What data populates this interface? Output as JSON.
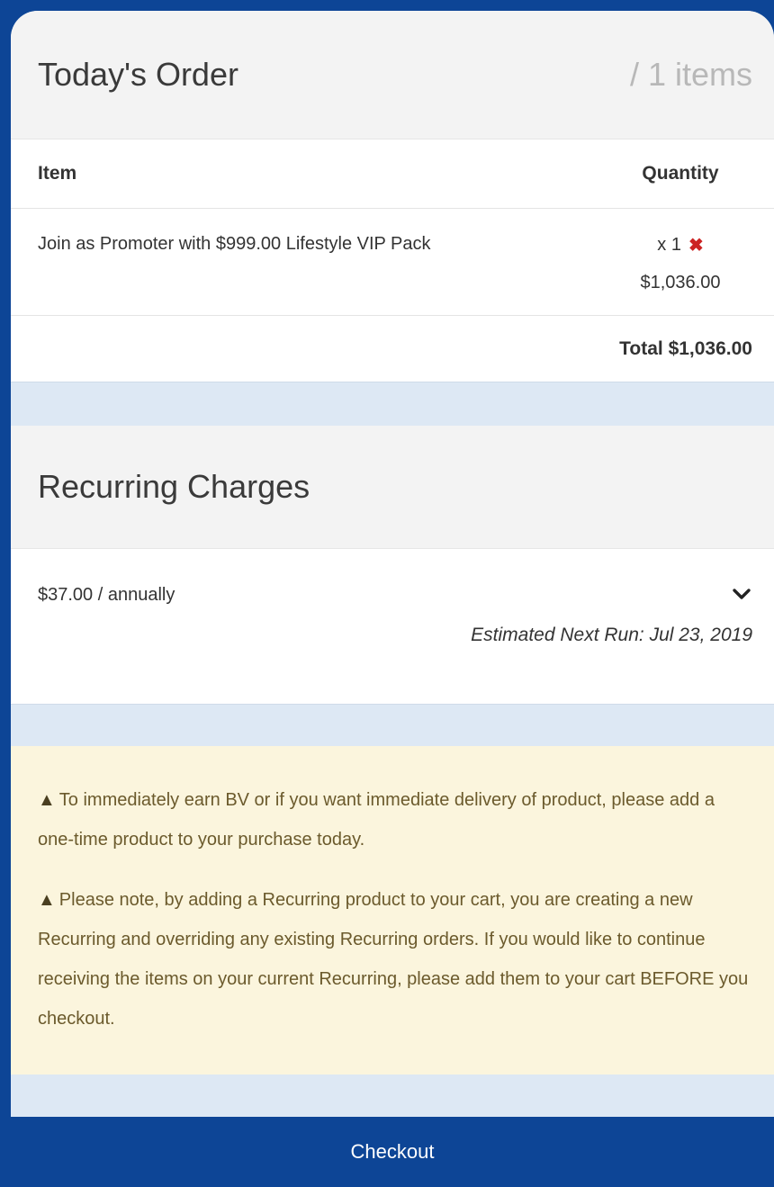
{
  "order": {
    "title": "Today's Order",
    "item_count": "/ 1 items",
    "columns": {
      "item": "Item",
      "quantity": "Quantity"
    },
    "items": [
      {
        "name": "Join as Promoter with $999.00 Lifestyle VIP Pack",
        "quantity": "x 1",
        "price": "$1,036.00"
      }
    ],
    "total": "Total $1,036.00"
  },
  "recurring": {
    "title": "Recurring Charges",
    "price": "$37.00 / annually",
    "next_run": "Estimated Next Run: Jul 23, 2019"
  },
  "notices": [
    "To immediately earn BV or if you want immediate delivery of product, please add a one-time product to your purchase today.",
    "Please note, by adding a Recurring product to your cart, you are creating a new Recurring and overriding any existing Recurring orders. If you would like to continue receiving the items on your current Recurring, please add them to your cart BEFORE you checkout."
  ],
  "checkout_label": "Checkout",
  "icons": {
    "remove": "close-icon",
    "expand": "chevron-down-icon",
    "warning": "warning-icon"
  },
  "colors": {
    "brand": "#0d4596",
    "remove": "#cc2222",
    "notice_bg": "#fbf5dd",
    "notice_text": "#6b5a2c"
  }
}
